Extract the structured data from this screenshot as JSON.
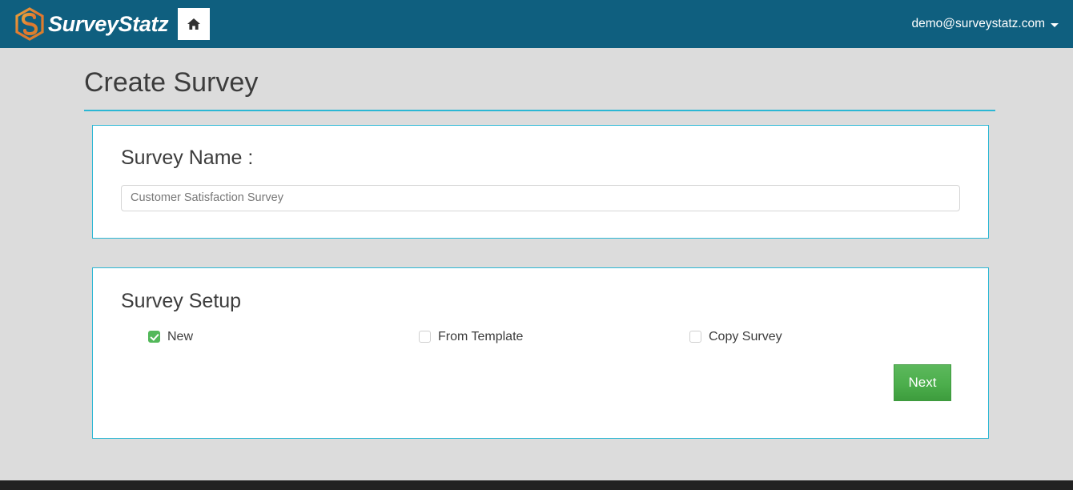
{
  "navbar": {
    "logo_icon": "hexagon-s-logo-icon",
    "brand_name": "SurveyStatz",
    "home_icon": "home-icon",
    "user_email": "demo@surveystatz.com",
    "caret_icon": "chevron-down-icon",
    "background_color": "#0f5f7f"
  },
  "page": {
    "title": "Create Survey",
    "accent_color": "#2cb7d4",
    "background_color": "#dcdcdc"
  },
  "survey_name_panel": {
    "heading": "Survey Name :",
    "input_value": "",
    "input_placeholder": "Customer Satisfaction Survey"
  },
  "survey_setup_panel": {
    "heading": "Survey Setup",
    "options": [
      {
        "label": "New",
        "checked": true
      },
      {
        "label": "From Template",
        "checked": false
      },
      {
        "label": "Copy Survey",
        "checked": false
      }
    ],
    "next_label": "Next",
    "next_color": "#4cae4c"
  }
}
